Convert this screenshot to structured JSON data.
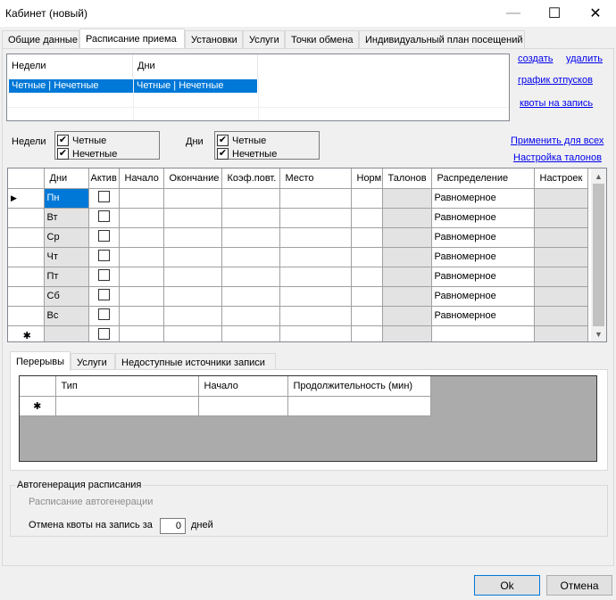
{
  "window": {
    "title": "Кабинет (новый)"
  },
  "tabs": [
    "Общие данные",
    "Расписание приема",
    "Установки",
    "Услуги",
    "Точки обмена",
    "Индивидуальный план посещений"
  ],
  "active_tab": "Расписание приема",
  "week_list": {
    "headers": [
      "Недели",
      "Дни"
    ],
    "rows": [
      [
        "Четные | Нечетные",
        "Четные | Нечетные"
      ]
    ]
  },
  "links": {
    "create": "создать",
    "delete": "удалить",
    "vacation": "график отпусков",
    "quotas": "квоты на запись",
    "apply_all": "Применить для всех",
    "ticket_settings": "Настройка талонов"
  },
  "filters": {
    "weeks_label": "Недели",
    "days_label": "Дни",
    "even": "Четные",
    "odd": "Нечетные",
    "weeks_even_checked": "✔",
    "weeks_odd_checked": "✔",
    "days_even_checked": "✔",
    "days_odd_checked": "✔"
  },
  "schedule_grid": {
    "columns": [
      "Дни",
      "Актив",
      "Начало",
      "Окончание",
      "Коэф.повт.",
      "Место",
      "Норм",
      "Талонов",
      "Распределение",
      "Настроек"
    ],
    "rows": [
      {
        "day": "Пн",
        "distribution": "Равномерное"
      },
      {
        "day": "Вт",
        "distribution": "Равномерное"
      },
      {
        "day": "Ср",
        "distribution": "Равномерное"
      },
      {
        "day": "Чт",
        "distribution": "Равномерное"
      },
      {
        "day": "Пт",
        "distribution": "Равномерное"
      },
      {
        "day": "Сб",
        "distribution": "Равномерное"
      },
      {
        "day": "Вс",
        "distribution": "Равномерное"
      }
    ],
    "current_row_marker": "▶",
    "new_row_marker": "✱"
  },
  "sub_tabs": [
    "Перерывы",
    "Услуги",
    "Недоступные источники записи"
  ],
  "breaks_grid": {
    "columns": [
      "Тип",
      "Начало",
      "Продолжительность (мин)"
    ],
    "new_row_marker": "✱"
  },
  "autogen": {
    "group_title": "Автогенерация расписания",
    "schedule_label": "Расписание автогенерации",
    "cancel_label": "Отмена квоты на запись за",
    "cancel_value": "0",
    "days_label": "дней"
  },
  "buttons": {
    "ok": "Ok",
    "cancel": "Отмена"
  }
}
